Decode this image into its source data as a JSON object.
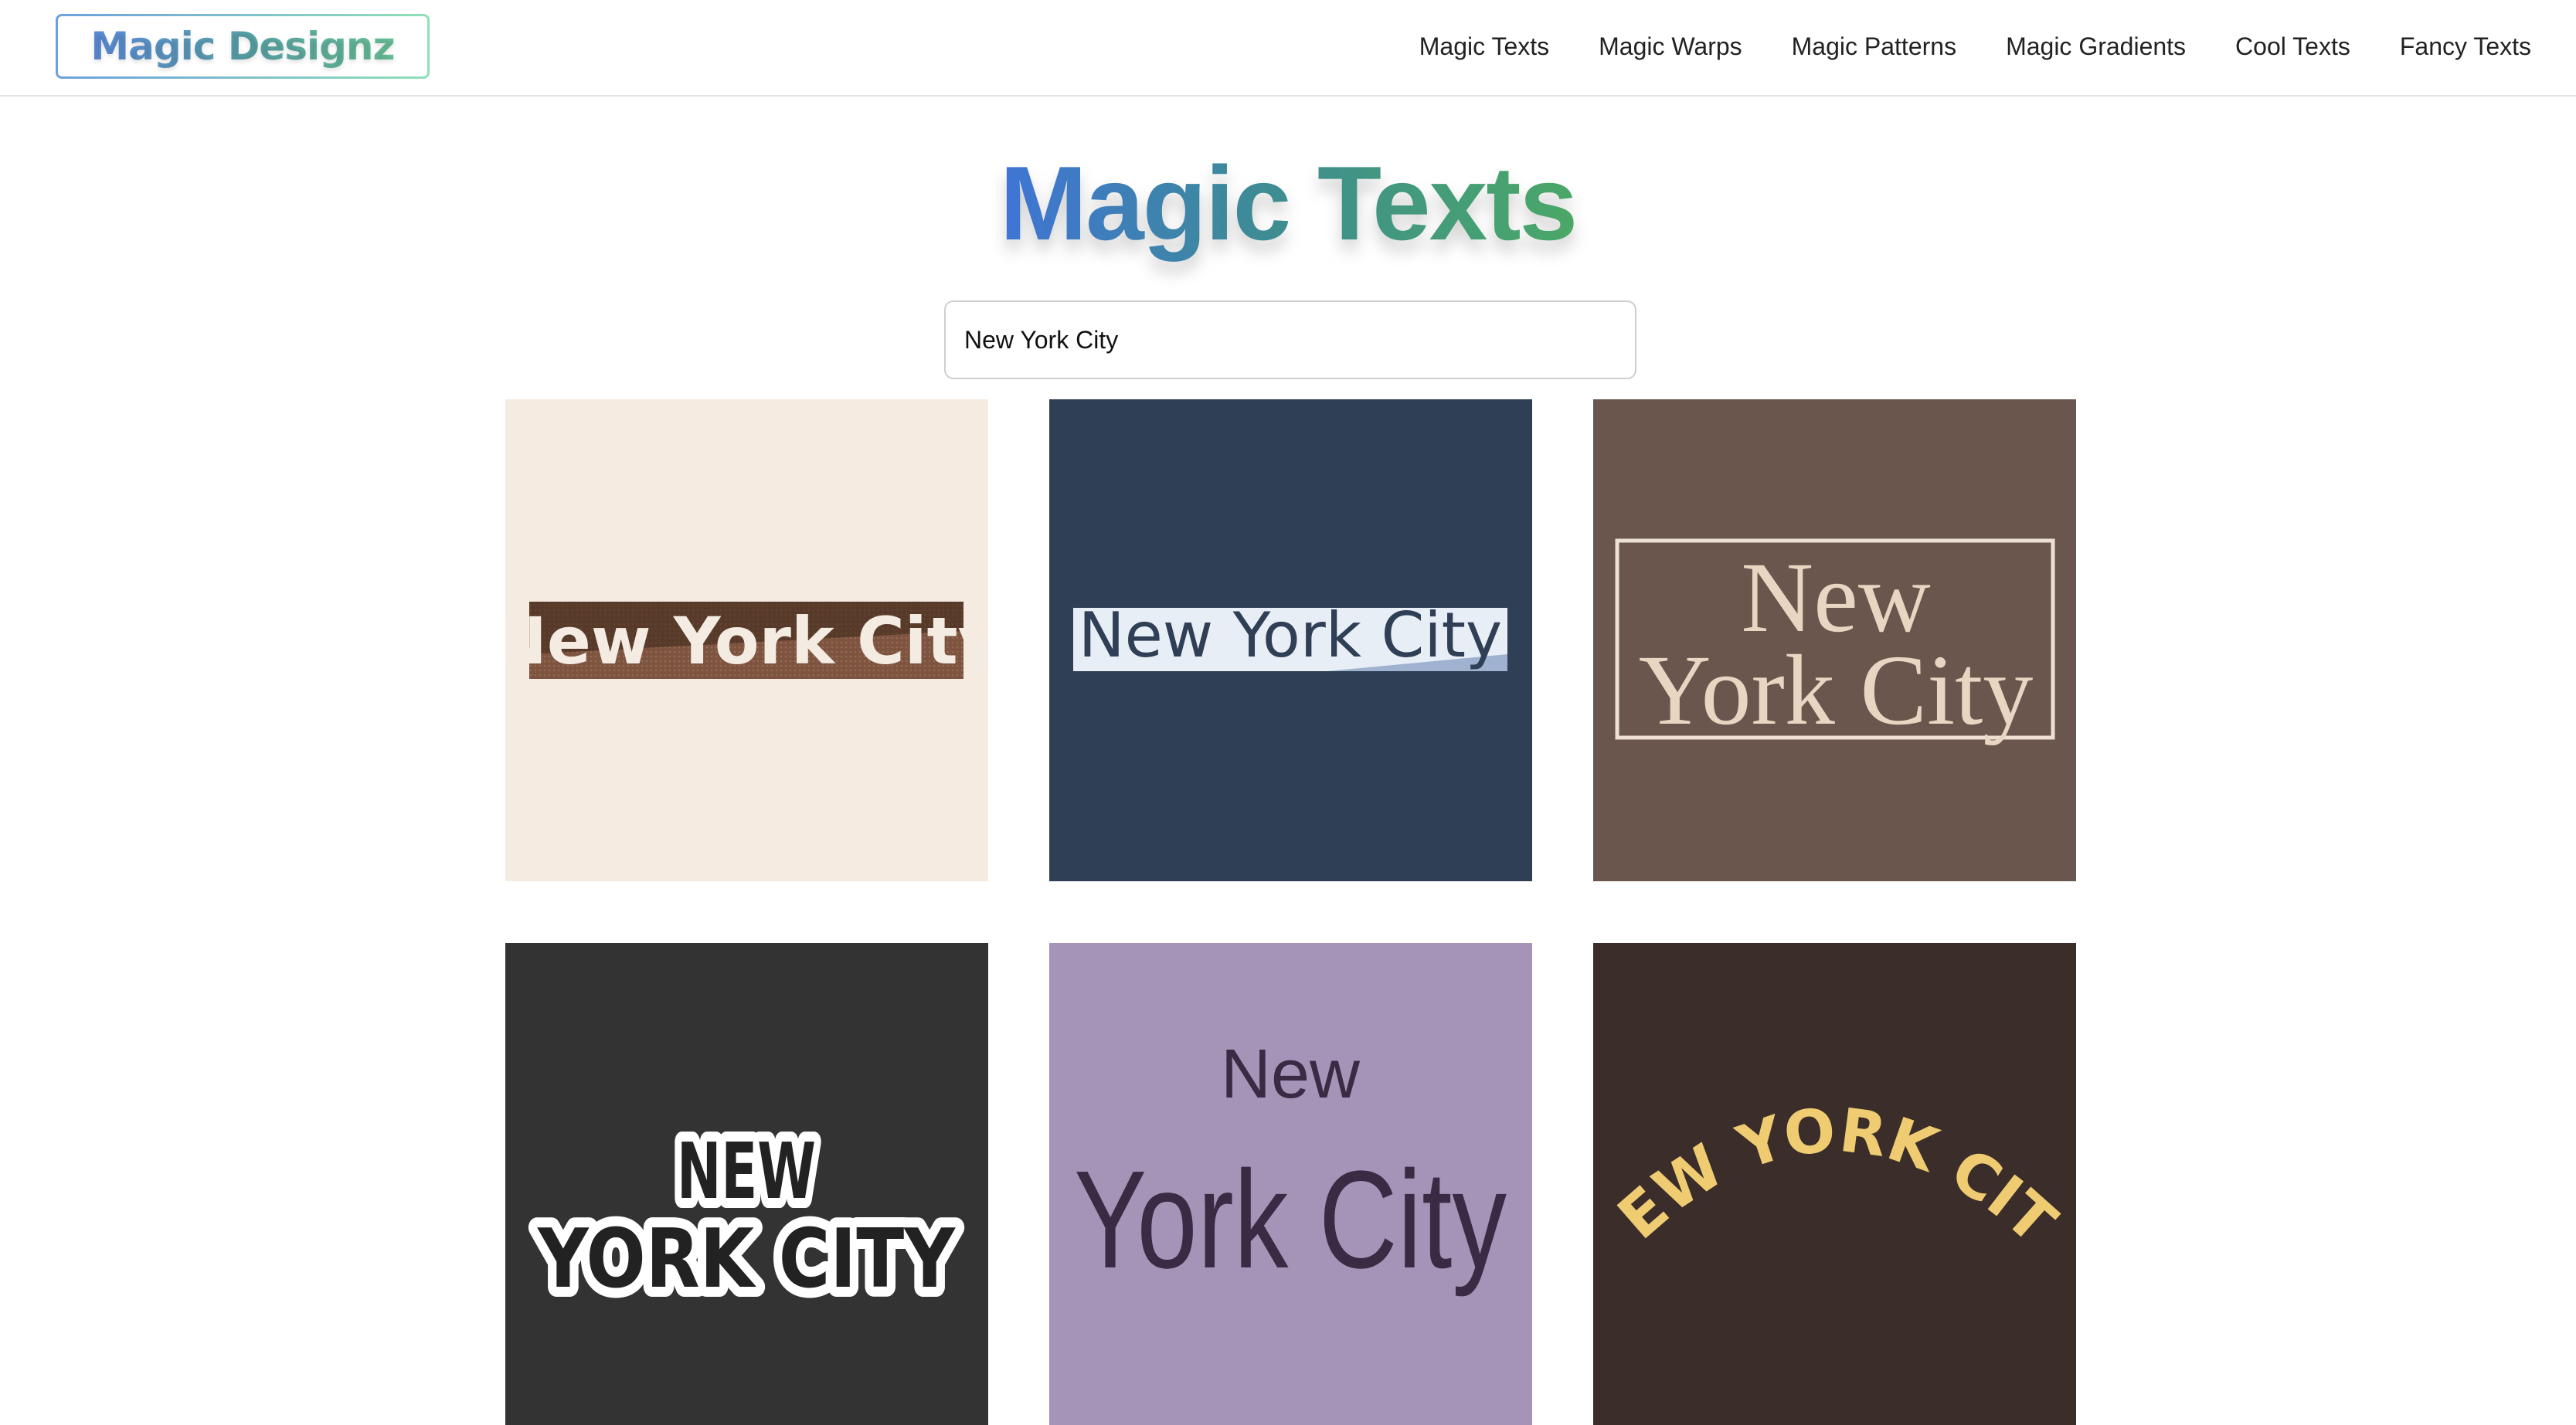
{
  "header": {
    "logo": "Magic Designz",
    "nav": [
      "Magic Texts",
      "Magic Warps",
      "Magic Patterns",
      "Magic Gradients",
      "Cool Texts",
      "Fancy Texts"
    ]
  },
  "title": "Magic Texts",
  "search": {
    "value": "New York City"
  },
  "cards": [
    {
      "text": "New York City",
      "background": "#f5ebe0"
    },
    {
      "text": "New York City",
      "background": "#2f3f55"
    },
    {
      "line1": "New",
      "line2": "York City",
      "background": "#6b564e"
    },
    {
      "line1": "NEW",
      "line2": "YORK CITY",
      "background": "#333333"
    },
    {
      "line1": "New",
      "line2": "York City",
      "background": "#a594b8"
    },
    {
      "text": "NEW YORK CITY",
      "background": "#3a2d2a"
    }
  ]
}
